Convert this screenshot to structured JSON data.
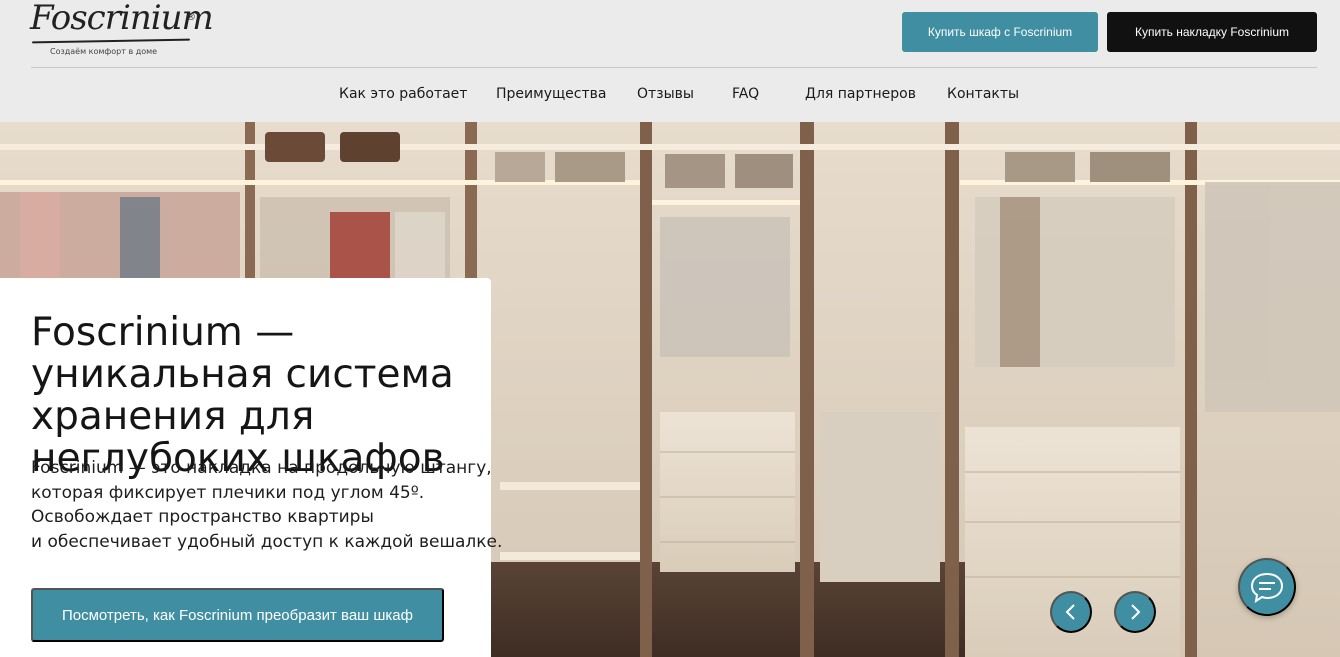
{
  "header": {
    "logo_text": "Foscrinium",
    "logo_mark": "®",
    "logo_tagline": "Создаём комфорт в доме",
    "buy_wardrobe_label": "Купить шкаф с Foscrinium",
    "buy_overlay_label": "Купить накладку Foscrinium"
  },
  "nav": {
    "items": [
      {
        "label": "Как это работает"
      },
      {
        "label": "Преимущества"
      },
      {
        "label": "Отзывы"
      },
      {
        "label": "FAQ"
      },
      {
        "label": "Для партнеров"
      },
      {
        "label": "Контакты"
      }
    ]
  },
  "hero": {
    "image": "walk-in-wardrobe-photo",
    "title": "Foscrinium — уникальная система хранения для неглубоких шкафов",
    "description_lines": [
      "Foscrinium — это накладка на продольную штангу,",
      "которая фиксирует плечики под углом 45º.",
      "Освобождает пространство квартиры",
      "и обеспечивает удобный доступ к каждой вешалке."
    ],
    "cta_label": "Посмотреть, как Foscrinium преобразит ваш шкаф",
    "prev_icon": "chevron-left-icon",
    "next_icon": "chevron-right-icon"
  },
  "chat": {
    "icon": "chat-bubble-icon"
  },
  "colors": {
    "accent": "#3f8ea2",
    "dark_button": "#111111",
    "header_bg": "#ebebeb"
  }
}
